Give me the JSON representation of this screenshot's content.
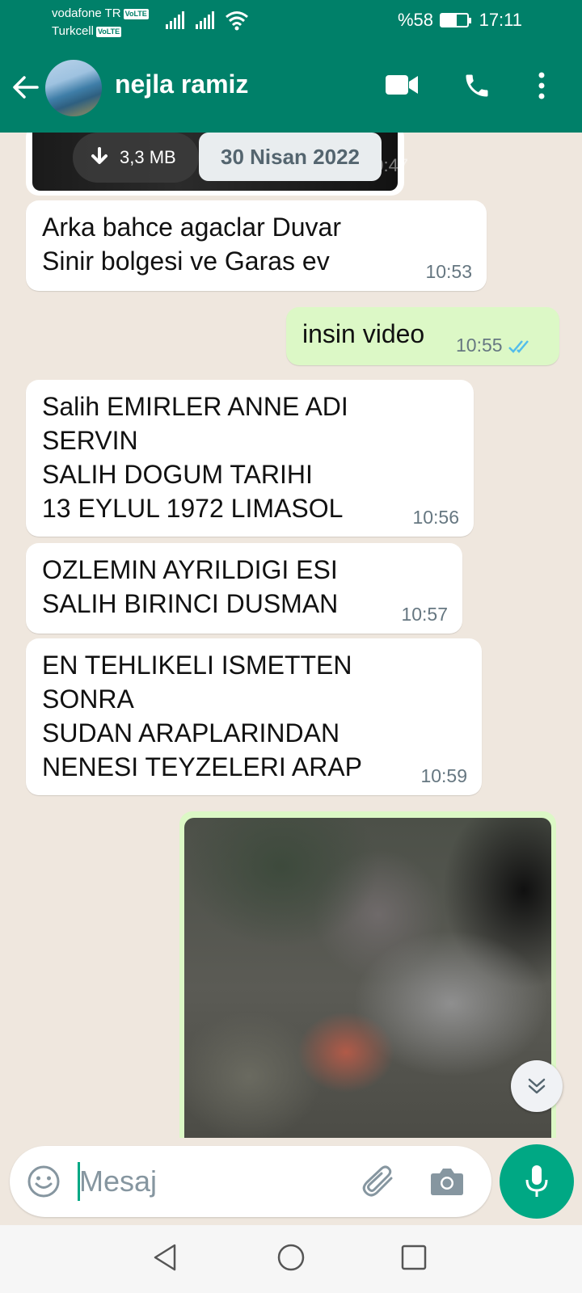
{
  "status_bar": {
    "carrier1": "vodafone TR",
    "carrier2": "Turkcell",
    "volte": "VoLTE",
    "battery_text": "%58",
    "battery_level": 0.58,
    "time": "17:11"
  },
  "header": {
    "contact_name": "nejla ramiz",
    "icons": [
      "back-arrow-icon",
      "video-call-icon",
      "phone-icon",
      "more-vert-icon"
    ]
  },
  "chat": {
    "media_size": "3,3 MB",
    "date_chip": "30 Nisan 2022",
    "media_time": "10:47",
    "messages": [
      {
        "dir": "in",
        "text": "Arka bahce agaclar   Duvar\nSinir  bolgesi  ve Garas ev",
        "time": "10:53"
      },
      {
        "dir": "out",
        "text": "insin video",
        "time": "10:55",
        "status": "read"
      },
      {
        "dir": "in",
        "text": "Salih EMIRLER  ANNE ADI\nSERVIN\nSALIH  DOGUM TARIHI\n13 EYLUL  1972 LIMASOL",
        "time": "10:56"
      },
      {
        "dir": "in",
        "text": "OZLEMIN  AYRILDIGI ESI\nSALIH BIRINCI  DUSMAN",
        "time": "10:57"
      },
      {
        "dir": "in",
        "text": "EN TEHLIKELI   ISMETTEN\nSONRA\nSUDAN ARAPLARINDAN\nNENESI TEYZELERI ARAP",
        "time": "10:59"
      }
    ]
  },
  "composer": {
    "placeholder": "Mesaj",
    "icons": [
      "emoji-icon",
      "attach-icon",
      "camera-icon",
      "mic-icon"
    ]
  },
  "colors": {
    "header": "#008069",
    "outgoing_bubble": "#dcf8c6",
    "incoming_bubble": "#ffffff",
    "accent": "#00a884",
    "read_ticks": "#53bdeb"
  }
}
